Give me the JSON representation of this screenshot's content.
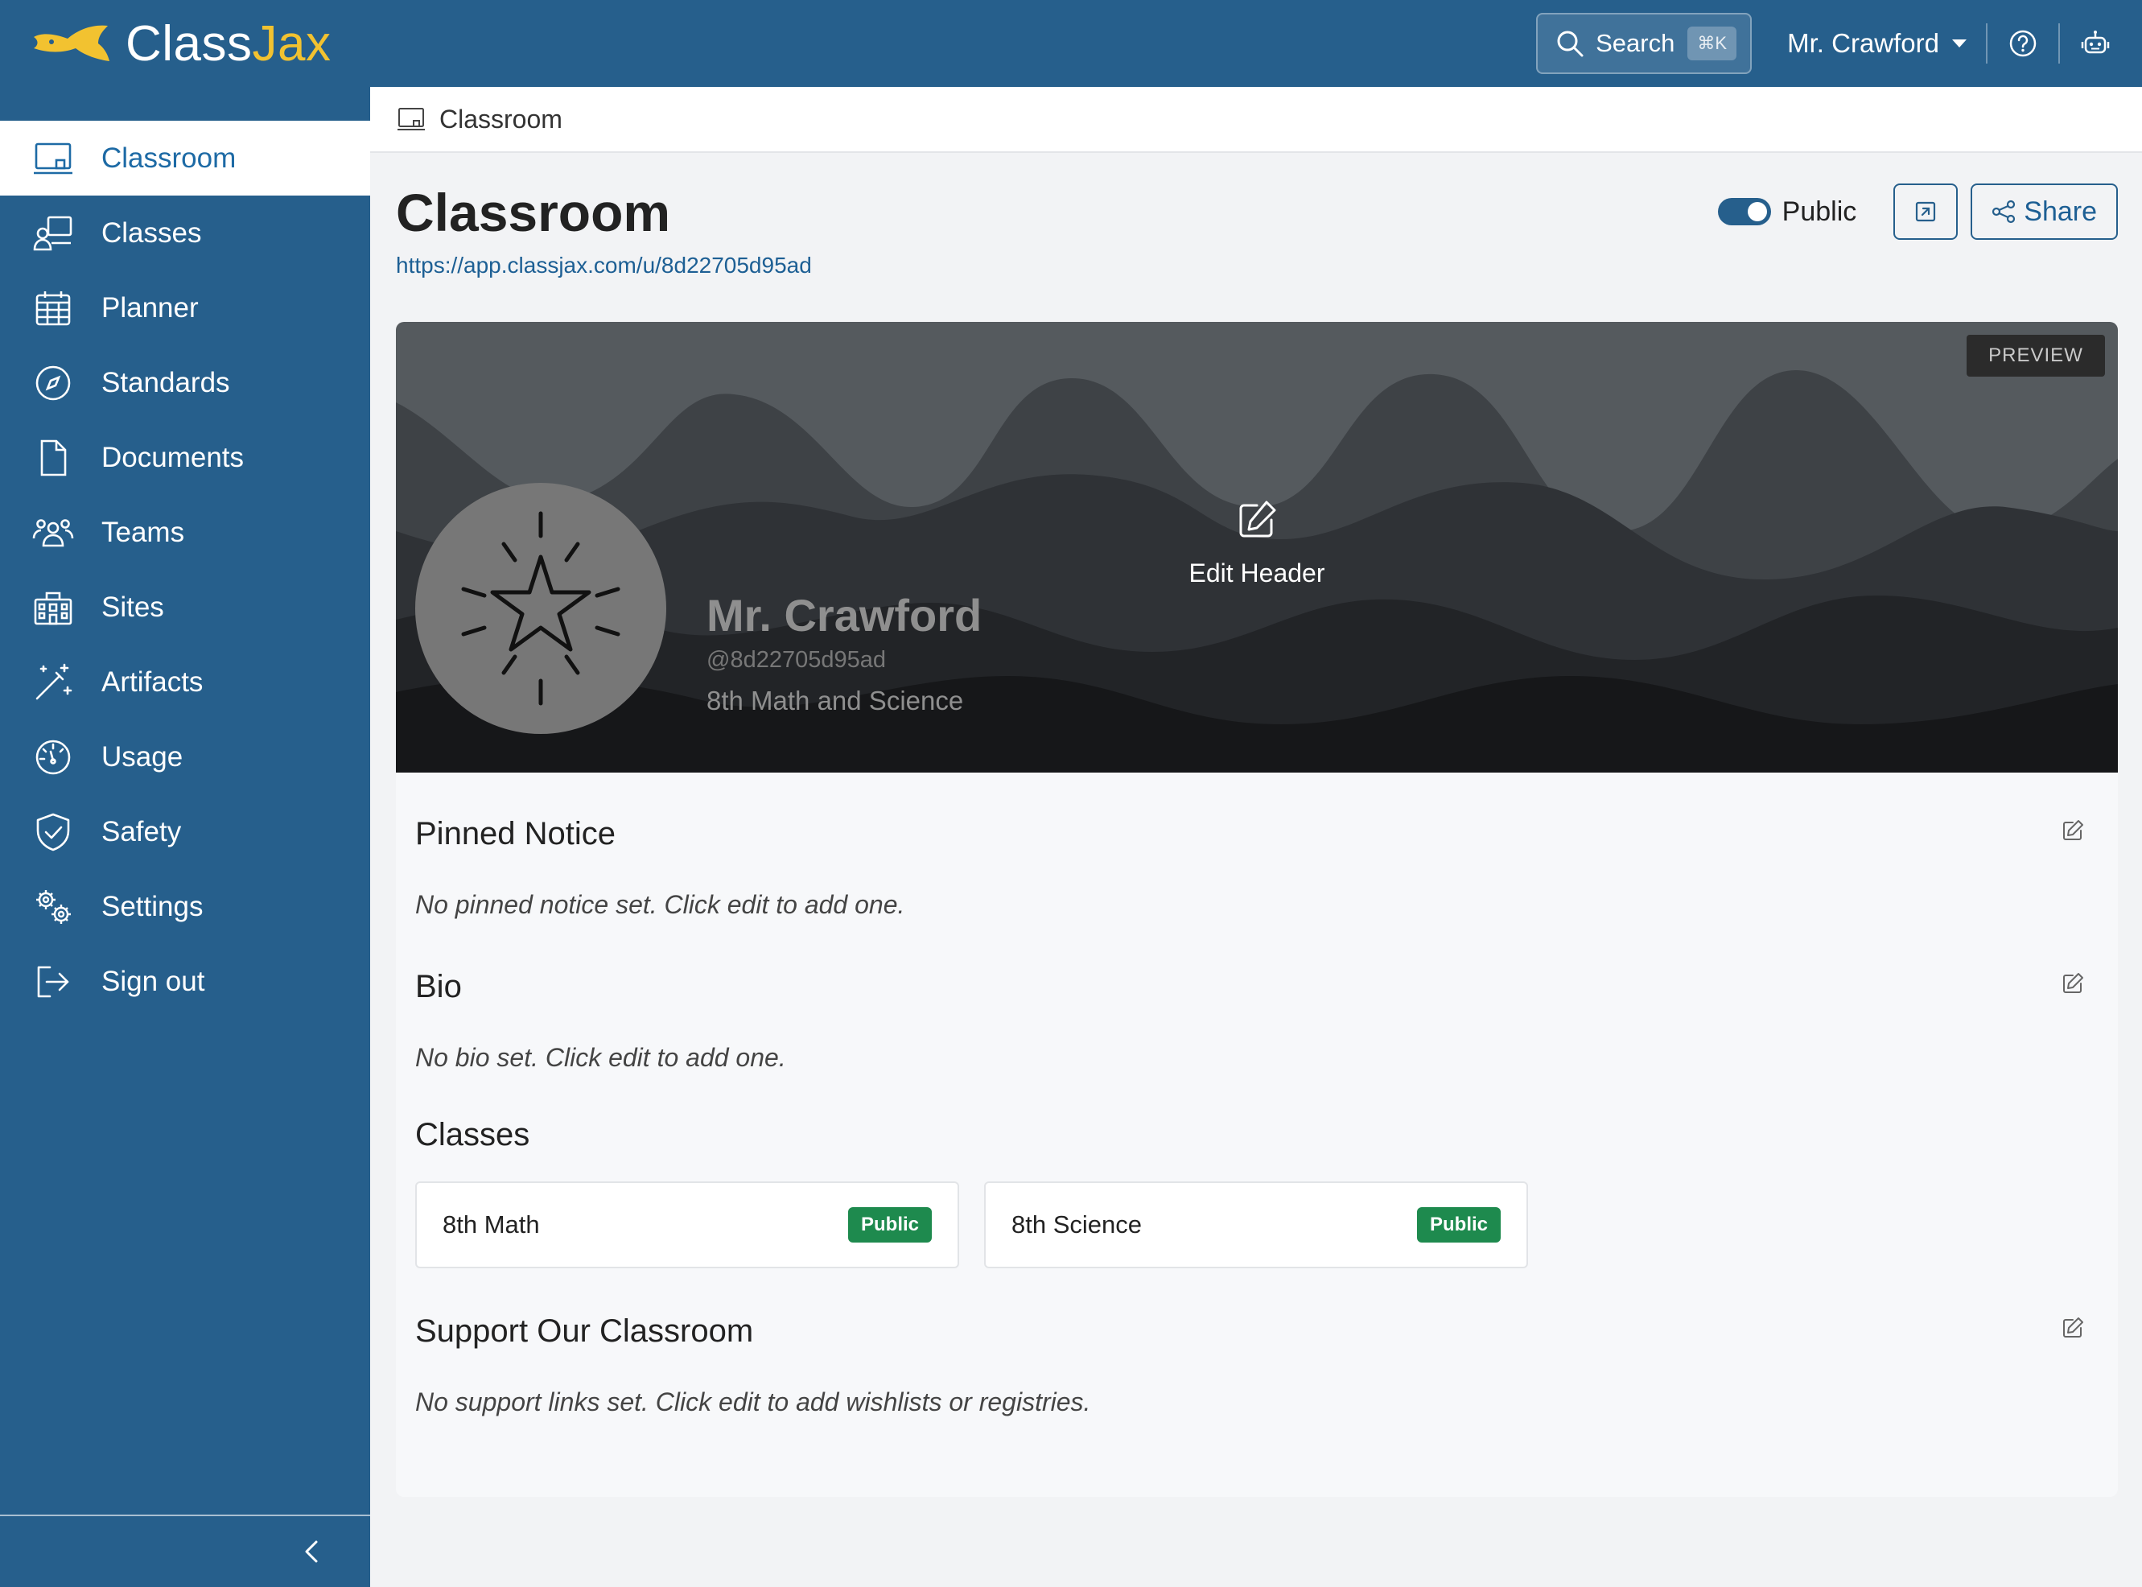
{
  "brand": {
    "name_part1": "Class",
    "name_part2": "Jax"
  },
  "topbar": {
    "search_label": "Search",
    "search_shortcut": "⌘K",
    "user_name": "Mr. Crawford"
  },
  "sidebar": {
    "items": [
      {
        "label": "Classroom",
        "icon": "classroom-icon",
        "active": true
      },
      {
        "label": "Classes",
        "icon": "classes-icon"
      },
      {
        "label": "Planner",
        "icon": "calendar-icon"
      },
      {
        "label": "Standards",
        "icon": "compass-icon"
      },
      {
        "label": "Documents",
        "icon": "document-icon"
      },
      {
        "label": "Teams",
        "icon": "people-icon"
      },
      {
        "label": "Sites",
        "icon": "building-icon"
      },
      {
        "label": "Artifacts",
        "icon": "magic-wand-icon"
      },
      {
        "label": "Usage",
        "icon": "speedometer-icon"
      },
      {
        "label": "Safety",
        "icon": "shield-check-icon"
      },
      {
        "label": "Settings",
        "icon": "gears-icon"
      },
      {
        "label": "Sign out",
        "icon": "sign-out-icon"
      }
    ]
  },
  "breadcrumb": {
    "label": "Classroom"
  },
  "page": {
    "title": "Classroom",
    "url": "https://app.classjax.com/u/8d22705d95ad",
    "public_toggle_label": "Public",
    "share_label": "Share"
  },
  "hero": {
    "preview_badge": "PREVIEW",
    "edit_header_label": "Edit Header",
    "name": "Mr. Crawford",
    "handle": "@8d22705d95ad",
    "subtitle": "8th Math and Science"
  },
  "sections": {
    "pinned": {
      "title": "Pinned Notice",
      "text": "No pinned notice set. Click edit to add one."
    },
    "bio": {
      "title": "Bio",
      "text": "No bio set. Click edit to add one."
    },
    "classes": {
      "title": "Classes",
      "items": [
        {
          "name": "8th Math",
          "status": "Public"
        },
        {
          "name": "8th Science",
          "status": "Public"
        }
      ]
    },
    "support": {
      "title": "Support Our Classroom",
      "text": "No support links set. Click edit to add wishlists or registries."
    }
  },
  "colors": {
    "primary": "#265f8c",
    "accent_yellow": "#f2c230",
    "link": "#1d5f94",
    "success": "#1e8a4e"
  }
}
